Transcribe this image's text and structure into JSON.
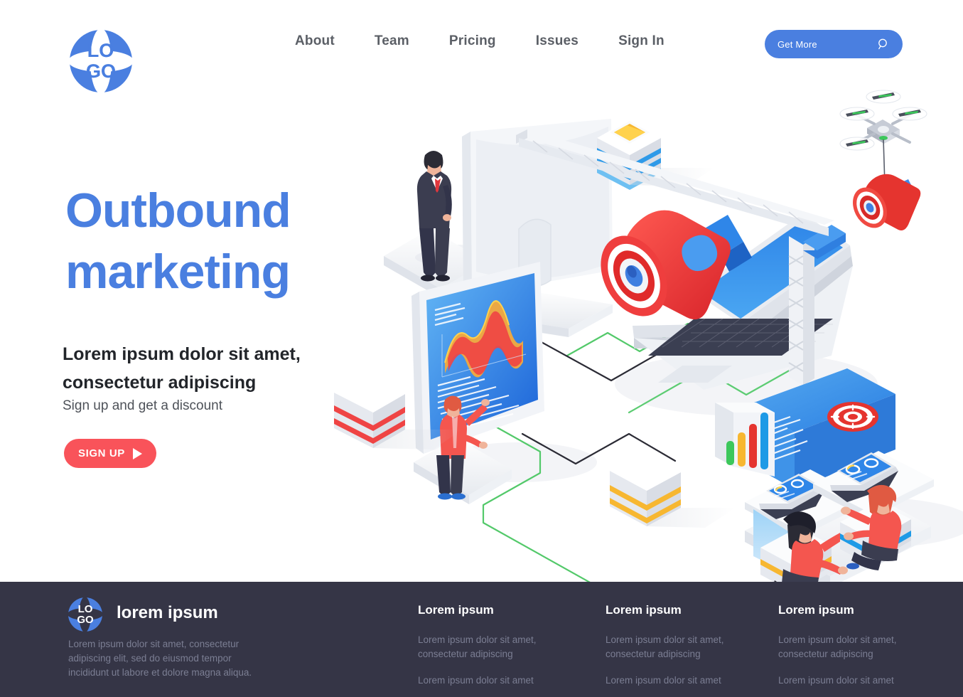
{
  "header": {
    "logo": {
      "line1": "LO",
      "line2": "GO",
      "alt": "logo"
    },
    "nav": [
      {
        "label": "About"
      },
      {
        "label": "Team"
      },
      {
        "label": "Pricing"
      },
      {
        "label": "Issues"
      },
      {
        "label": "Sign In"
      }
    ],
    "cta": {
      "label": "Get More",
      "icon": "search-icon"
    }
  },
  "hero": {
    "title_line1": "Outbound",
    "title_line2": "marketing",
    "subtitle_line1": "Lorem ipsum dolor sit amet,",
    "subtitle_line2": "consectetur adipiscing",
    "note": "Sign up and get a discount",
    "button": {
      "label": "SIGN UP",
      "icon": "play-icon"
    }
  },
  "illustration": {
    "alt": "isometric outbound marketing scene",
    "elements": [
      "businessman-standing",
      "desktop-monitor-back",
      "analytics-screen-with-wave-chart",
      "person-in-red-vest",
      "laptop-with-megaphone",
      "construction-crane",
      "drone-carrying-megaphone",
      "target-card",
      "bar-chart-panel",
      "two-workers-with-laptops",
      "stacked-box-red",
      "stacked-box-blue-folder",
      "stacked-box-yellow"
    ]
  },
  "footer": {
    "logo": {
      "line1": "LO",
      "line2": "GO"
    },
    "brand": "lorem ipsum",
    "description": "Lorem ipsum dolor sit amet, consectetur adipiscing elit, sed do eiusmod tempor incididunt ut labore et dolore magna aliqua.",
    "columns": [
      {
        "title": "Lorem ipsum",
        "links": [
          "Lorem ipsum dolor sit amet, consectetur adipiscing",
          "Lorem ipsum dolor sit amet"
        ]
      },
      {
        "title": "Lorem ipsum",
        "links": [
          "Lorem ipsum dolor sit amet, consectetur adipiscing",
          "Lorem ipsum dolor sit amet"
        ]
      },
      {
        "title": "Lorem ipsum",
        "links": [
          "Lorem ipsum dolor sit amet, consectetur adipiscing",
          "Lorem ipsum dolor sit amet"
        ]
      }
    ]
  },
  "colors": {
    "brand_blue": "#4a7fe0",
    "accent_red": "#f9535a",
    "footer_bg": "#353546",
    "nav_text": "#5b5f66",
    "heading_dark": "#22252a",
    "muted": "#7b7e93",
    "chart_green": "#3cc75b",
    "chart_yellow": "#f7b731",
    "chart_red": "#e5342f",
    "chart_blue": "#1e9ae6"
  }
}
